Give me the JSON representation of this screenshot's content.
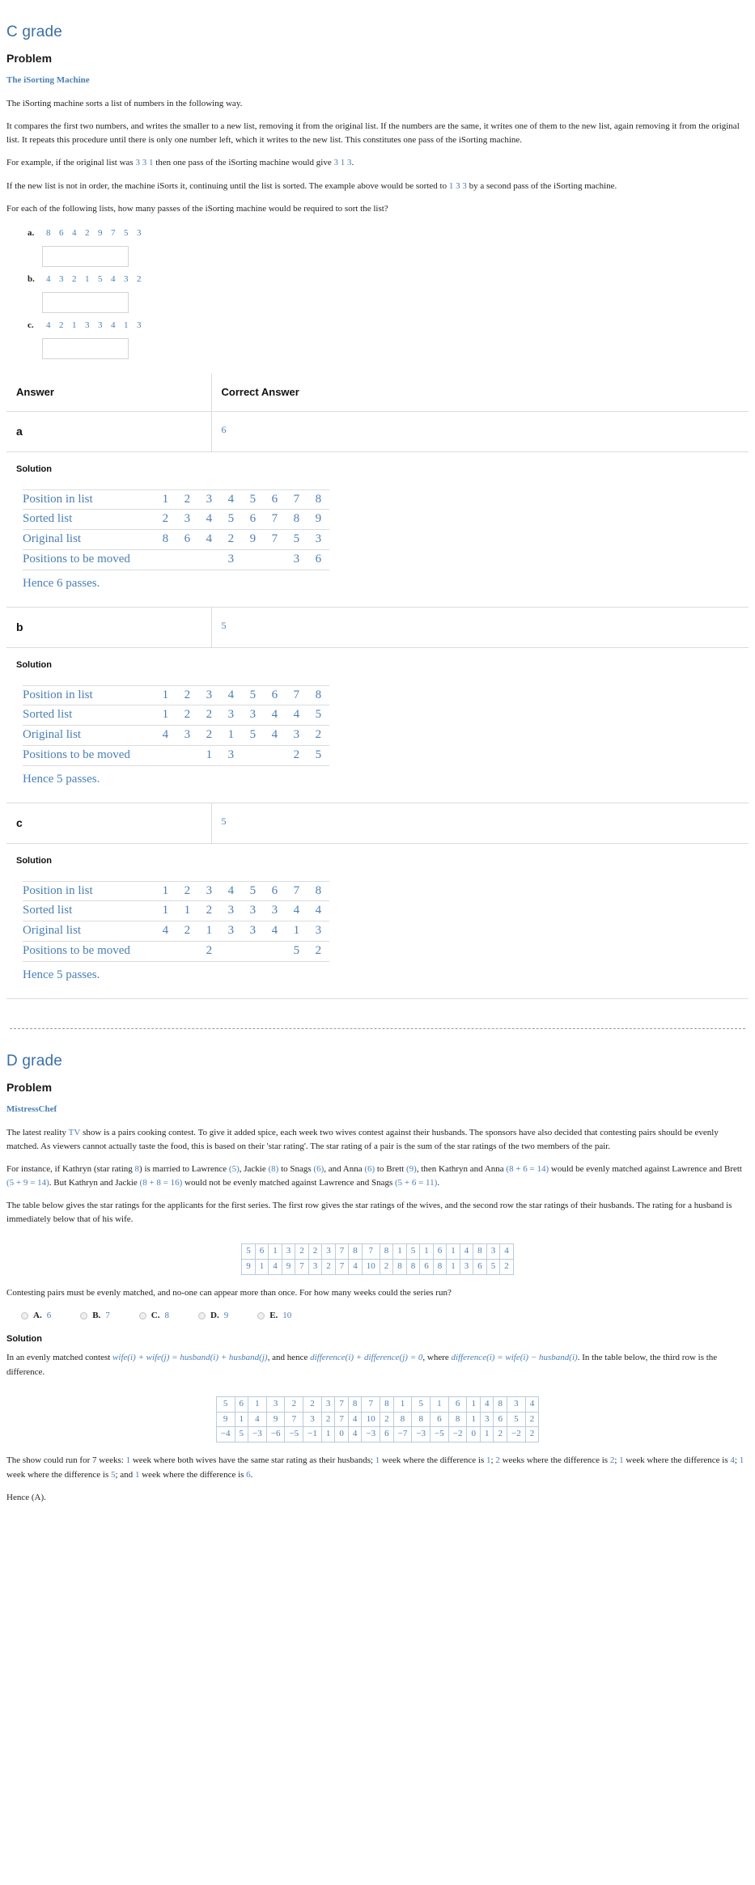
{
  "sections": {
    "c": {
      "grade_title": "C grade",
      "problem_label": "Problem",
      "question_title": "The iSorting Machine",
      "p1": "The iSorting machine sorts a list of numbers in the following way.",
      "p2a": "It compares the first two numbers, and writes the smaller to a new list, removing it from the original list. If the numbers are the same, it writes one of them to the new list, again removing it from the original list. It repeats this procedure until there is only one number left, which it writes to the new list. This constitutes one pass of the iSorting machine.",
      "p3_pre": "For example, if the original list was ",
      "p3_m1": "3 3 1",
      "p3_mid": " then one pass of the iSorting machine would give ",
      "p3_m2": "3 1 3",
      "p3_end": ".",
      "p4_pre": "If the new list is not in order, the machine iSorts it, continuing until the list is sorted. The example above would be sorted to ",
      "p4_m1": "1 3 3",
      "p4_end": " by a second pass of the iSorting machine.",
      "p5": "For each of the following lists, how many passes of the iSorting machine would be required to sort the list?",
      "items": [
        {
          "marker": "a.",
          "numbers": [
            8,
            6,
            4,
            2,
            9,
            7,
            5,
            3
          ],
          "input_value": "",
          "input_placeholder": ""
        },
        {
          "marker": "b.",
          "numbers": [
            4,
            3,
            2,
            1,
            5,
            4,
            3,
            2
          ],
          "input_value": "",
          "input_placeholder": ""
        },
        {
          "marker": "c.",
          "numbers": [
            4,
            2,
            1,
            3,
            3,
            4,
            1,
            3
          ],
          "input_value": "",
          "input_placeholder": ""
        }
      ],
      "table": {
        "header_answer": "Answer",
        "header_correct": "Correct Answer",
        "solution_label": "Solution",
        "rows": [
          {
            "part": "a",
            "correct": "6",
            "labels": [
              "Position in list",
              "Sorted list",
              "Original list",
              "Positions to be moved"
            ],
            "position_in_list": [
              "1",
              "2",
              "3",
              "4",
              "5",
              "6",
              "7",
              "8"
            ],
            "sorted_list": [
              "2",
              "3",
              "4",
              "5",
              "6",
              "7",
              "8",
              "9"
            ],
            "original_list": [
              "8",
              "6",
              "4",
              "2",
              "9",
              "7",
              "5",
              "3"
            ],
            "positions_to_be_moved": [
              "",
              "",
              "",
              "3",
              "",
              "",
              "3",
              "6"
            ],
            "hence": "Hence 6 passes."
          },
          {
            "part": "b",
            "correct": "5",
            "labels": [
              "Position in list",
              "Sorted list",
              "Original list",
              "Positions to be moved"
            ],
            "position_in_list": [
              "1",
              "2",
              "3",
              "4",
              "5",
              "6",
              "7",
              "8"
            ],
            "sorted_list": [
              "1",
              "2",
              "2",
              "3",
              "3",
              "4",
              "4",
              "5"
            ],
            "original_list": [
              "4",
              "3",
              "2",
              "1",
              "5",
              "4",
              "3",
              "2"
            ],
            "positions_to_be_moved": [
              "",
              "",
              "1",
              "3",
              "",
              "",
              "2",
              "5"
            ],
            "hence": "Hence 5 passes."
          },
          {
            "part": "c",
            "correct": "5",
            "labels": [
              "Position in list",
              "Sorted list",
              "Original list",
              "Positions to be moved"
            ],
            "position_in_list": [
              "1",
              "2",
              "3",
              "4",
              "5",
              "6",
              "7",
              "8"
            ],
            "sorted_list": [
              "1",
              "1",
              "2",
              "3",
              "3",
              "3",
              "4",
              "4"
            ],
            "original_list": [
              "4",
              "2",
              "1",
              "3",
              "3",
              "4",
              "1",
              "3"
            ],
            "positions_to_be_moved": [
              "",
              "",
              "2",
              "",
              "",
              "",
              "5",
              "2"
            ],
            "hence": "Hence 5 passes."
          }
        ]
      }
    },
    "d": {
      "grade_title": "D grade",
      "problem_label": "Problem",
      "question_title": "MistressChef",
      "p1_pre": "The latest reality ",
      "p1_tv": "TV",
      "p1_post": " show is a pairs cooking contest. To give it added spice, each week two wives contest against their husbands. The sponsors have also decided that contesting pairs should be evenly matched. As viewers cannot actually taste the food, this is based on their 'star rating'. The star rating of a pair is the sum of the star ratings of the two members of the pair.",
      "p2_parts": [
        "For instance, if Kathryn (star rating ",
        "8",
        ") is married to Lawrence ",
        "(5)",
        ", Jackie ",
        "(8)",
        " to Snags ",
        "(6)",
        ", and Anna ",
        "(6)",
        " to Brett ",
        "(9)",
        ", then Kathryn and Anna ",
        "(8 + 6 = 14)",
        " would be evenly matched against Lawrence and Brett ",
        "(5 + 9 = 14)",
        ". But Kathryn and Jackie ",
        "(8 + 8 = 16)",
        " would not be evenly matched against Lawrence and Snags ",
        "(5 + 6 = 11)",
        "."
      ],
      "p3": "The table below gives the star ratings for the applicants for the first series. The first row gives the star ratings of the wives, and the second row the star ratings of their husbands. The rating for a husband is immediately below that of his wife.",
      "stars_table": {
        "wives": [
          5,
          6,
          1,
          3,
          2,
          2,
          3,
          7,
          8,
          7,
          8,
          1,
          5,
          1,
          6,
          1,
          4,
          8,
          3,
          4
        ],
        "husbands": [
          9,
          1,
          4,
          9,
          7,
          3,
          2,
          7,
          4,
          10,
          2,
          8,
          8,
          6,
          8,
          1,
          3,
          6,
          5,
          2
        ]
      },
      "p4": "Contesting pairs must be evenly matched, and no-one can appear more than once. For how many weeks could the series run?",
      "choices": [
        {
          "label": "A.",
          "value": "6"
        },
        {
          "label": "B.",
          "value": "7"
        },
        {
          "label": "C.",
          "value": "8"
        },
        {
          "label": "D.",
          "value": "9"
        },
        {
          "label": "E.",
          "value": "10"
        }
      ],
      "solution_label": "Solution",
      "sol_p1_parts": [
        "In an evenly matched contest ",
        "wife(i) + wife(j) = husband(i) + husband(j)",
        ", and hence ",
        "difference(i) + difference(j) = 0",
        ", where ",
        "difference(i) = wife(i) − husband(i)",
        ". In the table below, the third row is the difference."
      ],
      "diff_table": {
        "wives": [
          5,
          6,
          1,
          3,
          2,
          2,
          3,
          7,
          8,
          7,
          8,
          1,
          5,
          1,
          6,
          1,
          4,
          8,
          3,
          4
        ],
        "husbands": [
          9,
          1,
          4,
          9,
          7,
          3,
          2,
          7,
          4,
          10,
          2,
          8,
          8,
          6,
          8,
          1,
          3,
          6,
          5,
          2
        ],
        "difference": [
          "−4",
          "5",
          "−3",
          "−6",
          "−5",
          "−1",
          "1",
          "0",
          "4",
          "−3",
          "6",
          "−7",
          "−3",
          "−5",
          "−2",
          "0",
          "1",
          "2",
          "−2",
          "2"
        ]
      },
      "sol_p2_parts": [
        "The show could run for 7 weeks: ",
        "1",
        " week where both wives have the same star rating as their husbands; ",
        "1",
        " week where the difference is ",
        "1",
        "; ",
        "2",
        " weeks where the difference is ",
        "2",
        "; ",
        "1",
        " week where the difference is ",
        "4",
        "; ",
        "1",
        " week where the difference is ",
        "5",
        "; and ",
        "1",
        " week where the difference is ",
        "6",
        "."
      ],
      "sol_p3": "Hence (A)."
    }
  }
}
